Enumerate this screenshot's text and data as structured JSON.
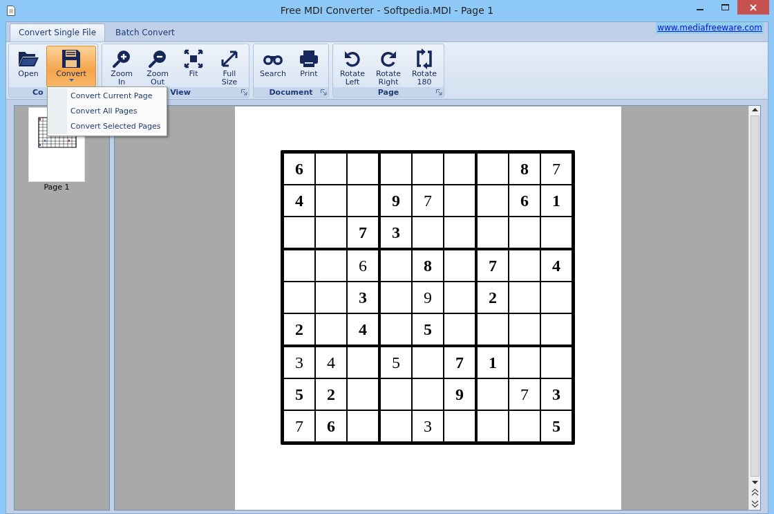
{
  "window": {
    "title": "Free MDI Converter - Softpedia.MDI - Page 1"
  },
  "tabs": [
    {
      "label": "Convert Single File",
      "selected": true
    },
    {
      "label": "Batch Convert",
      "selected": false
    }
  ],
  "link": "www.mediafreeware.com",
  "ribbon_groups": [
    {
      "label": "Co",
      "buttons": [
        {
          "label": "Open",
          "active": false,
          "dropdown": false
        },
        {
          "label": "Convert",
          "active": true,
          "dropdown": true
        }
      ]
    },
    {
      "label": "View",
      "buttons": [
        {
          "label": "Zoom\nIn",
          "active": false,
          "dropdown": false
        },
        {
          "label": "Zoom\nOut",
          "active": false,
          "dropdown": false
        },
        {
          "label": "Fit",
          "active": false,
          "dropdown": false
        },
        {
          "label": "Full\nSize",
          "active": false,
          "dropdown": false
        }
      ]
    },
    {
      "label": "Document",
      "buttons": [
        {
          "label": "Search",
          "active": false,
          "dropdown": false
        },
        {
          "label": "Print",
          "active": false,
          "dropdown": false
        }
      ]
    },
    {
      "label": "Page",
      "buttons": [
        {
          "label": "Rotate\nLeft",
          "active": false,
          "dropdown": false
        },
        {
          "label": "Rotate\nRight",
          "active": false,
          "dropdown": false
        },
        {
          "label": "Rotate\n180",
          "active": false,
          "dropdown": false
        }
      ]
    }
  ],
  "menu": {
    "items": [
      "Convert Current Page",
      "Convert All Pages",
      "Convert Selected Pages"
    ]
  },
  "thumbnails": [
    {
      "label": "Page 1",
      "selected": true
    }
  ],
  "sudoku": [
    [
      {
        "kind": "given",
        "value": "6"
      },
      {
        "kind": "empty"
      },
      {
        "kind": "empty"
      },
      {
        "kind": "empty"
      },
      {
        "kind": "empty"
      },
      {
        "kind": "empty"
      },
      {
        "kind": "empty"
      },
      {
        "kind": "given",
        "value": "8"
      },
      {
        "kind": "entered",
        "value": "7"
      }
    ],
    [
      {
        "kind": "given",
        "value": "4"
      },
      {
        "kind": "empty"
      },
      {
        "kind": "empty"
      },
      {
        "kind": "given",
        "value": "9"
      },
      {
        "kind": "entered",
        "value": "7"
      },
      {
        "kind": "empty"
      },
      {
        "kind": "empty"
      },
      {
        "kind": "given",
        "value": "6"
      },
      {
        "kind": "given",
        "value": "1"
      }
    ],
    [
      {
        "kind": "empty"
      },
      {
        "kind": "empty"
      },
      {
        "kind": "given",
        "value": "7"
      },
      {
        "kind": "given",
        "value": "3"
      },
      {
        "kind": "empty"
      },
      {
        "kind": "empty"
      },
      {
        "kind": "empty"
      },
      {
        "kind": "empty"
      },
      {
        "kind": "empty"
      }
    ],
    [
      {
        "kind": "empty"
      },
      {
        "kind": "empty"
      },
      {
        "kind": "entered",
        "value": "6"
      },
      {
        "kind": "empty"
      },
      {
        "kind": "given",
        "value": "8"
      },
      {
        "kind": "empty"
      },
      {
        "kind": "given",
        "value": "7"
      },
      {
        "kind": "empty"
      },
      {
        "kind": "given",
        "value": "4"
      }
    ],
    [
      {
        "kind": "empty"
      },
      {
        "kind": "empty"
      },
      {
        "kind": "given",
        "value": "3"
      },
      {
        "kind": "empty"
      },
      {
        "kind": "entered",
        "value": "9"
      },
      {
        "kind": "empty"
      },
      {
        "kind": "given",
        "value": "2"
      },
      {
        "kind": "empty"
      },
      {
        "kind": "empty"
      }
    ],
    [
      {
        "kind": "given",
        "value": "2"
      },
      {
        "kind": "empty"
      },
      {
        "kind": "given",
        "value": "4"
      },
      {
        "kind": "empty"
      },
      {
        "kind": "given",
        "value": "5"
      },
      {
        "kind": "empty"
      },
      {
        "kind": "empty"
      },
      {
        "kind": "empty"
      },
      {
        "kind": "empty"
      }
    ],
    [
      {
        "kind": "entered",
        "value": "3"
      },
      {
        "kind": "entered",
        "value": "4"
      },
      {
        "kind": "empty"
      },
      {
        "kind": "entered",
        "value": "5"
      },
      {
        "kind": "empty"
      },
      {
        "kind": "given",
        "value": "7"
      },
      {
        "kind": "given",
        "value": "1"
      },
      {
        "kind": "empty"
      },
      {
        "kind": "empty"
      }
    ],
    [
      {
        "kind": "given",
        "value": "5"
      },
      {
        "kind": "given",
        "value": "2"
      },
      {
        "kind": "empty"
      },
      {
        "kind": "empty"
      },
      {
        "kind": "empty"
      },
      {
        "kind": "given",
        "value": "9"
      },
      {
        "kind": "empty"
      },
      {
        "kind": "entered",
        "value": "7"
      },
      {
        "kind": "given",
        "value": "3"
      }
    ],
    [
      {
        "kind": "entered",
        "value": "7"
      },
      {
        "kind": "given",
        "value": "6"
      },
      {
        "kind": "empty"
      },
      {
        "kind": "empty"
      },
      {
        "kind": "entered",
        "value": "3"
      },
      {
        "kind": "empty"
      },
      {
        "kind": "empty"
      },
      {
        "kind": "empty"
      },
      {
        "kind": "given",
        "value": "5"
      }
    ]
  ]
}
